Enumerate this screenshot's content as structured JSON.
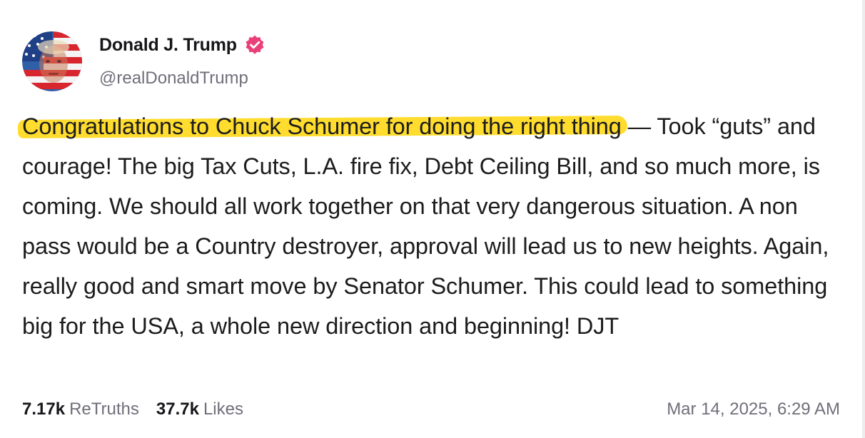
{
  "author": {
    "display_name": "Donald J. Trump",
    "handle": "@realDonaldTrump",
    "verified_icon": "verified-badge-icon",
    "badge_color": "#e9407a",
    "avatar": "avatar"
  },
  "post": {
    "highlighted_text": "Congratulations to Chuck Schumer for doing the right thing",
    "body_text": " — Took “guts” and courage! The big Tax Cuts, L.A. fire fix, Debt Ceiling Bill, and so much more, is coming. We should all work together on that very dangerous situation. A non pass would be a Country destroyer, approval will lead us to new heights. Again, really good and smart move by Senator Schumer. This could lead to something big for the USA, a whole new direction and beginning! DJT",
    "highlight_color": "#ffdc2e"
  },
  "stats": {
    "retruths_count": "7.17k",
    "retruths_label": "ReTruths",
    "likes_count": "37.7k",
    "likes_label": "Likes"
  },
  "timestamp": "Mar 14, 2025, 6:29 AM"
}
